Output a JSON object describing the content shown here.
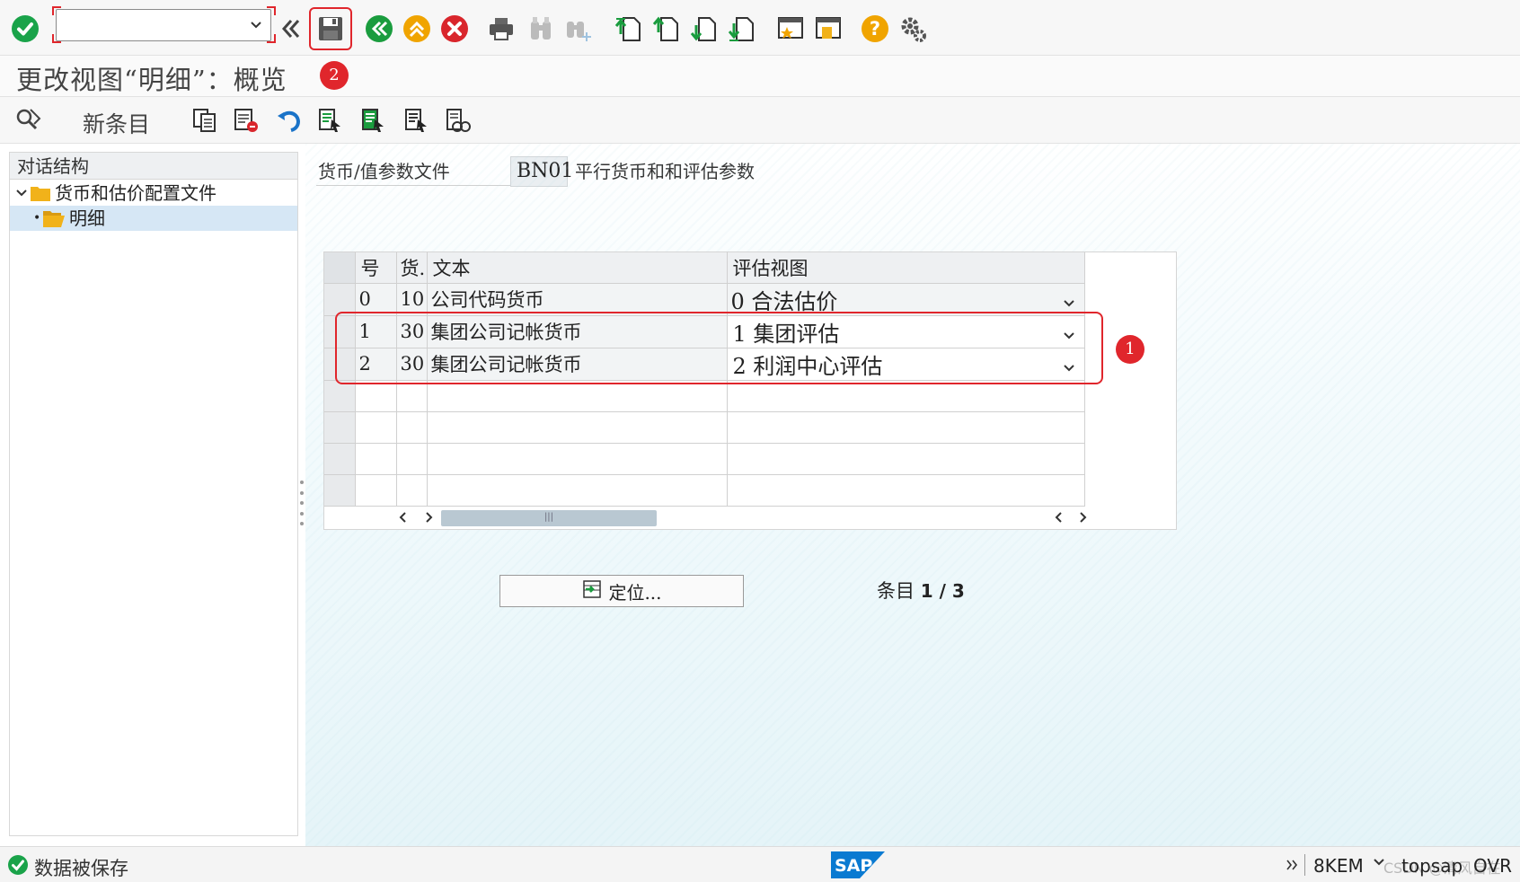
{
  "colors": {
    "check_green": "#1aa34a",
    "nav_green": "#1a9c3e",
    "nav_orange": "#f0a400",
    "cancel_red": "#d9262c",
    "highlight_red": "#e0262c",
    "selection_blue": "#d6e7f5",
    "folder_yellow": "#f1b21a"
  },
  "toolbar": {
    "command_field_value": "",
    "icons": [
      "enter-check-icon",
      "command-field",
      "back-chevron-icon",
      "save-icon",
      "back-icon",
      "exit-icon",
      "cancel-icon",
      "print-icon",
      "find-icon",
      "find-next-icon",
      "first-page-icon",
      "previous-page-icon",
      "next-page-icon",
      "last-page-icon",
      "create-shortcut-icon",
      "new-session-icon",
      "help-icon",
      "customize-layout-icon"
    ]
  },
  "title": "更改视图“明细”：概览",
  "app_toolbar": {
    "new_entries_label": "新条目"
  },
  "tree": {
    "header": "对话结构",
    "nodes": [
      {
        "label": "货币和估价配置文件",
        "level": 0,
        "expanded": true
      },
      {
        "label": "明细",
        "level": 1,
        "selected": true
      }
    ]
  },
  "param": {
    "label": "货币/值参数文件",
    "value": "BN01",
    "description": "平行货币和和评估参数"
  },
  "table": {
    "columns": [
      "号",
      "货.",
      "文本",
      "评估视图"
    ],
    "rows": [
      {
        "no": "0",
        "cur": "10",
        "text": "公司代码货币",
        "view": "0  合法估价"
      },
      {
        "no": "1",
        "cur": "30",
        "text": "集团公司记帐货币",
        "view": "1  集团评估"
      },
      {
        "no": "2",
        "cur": "30",
        "text": "集团公司记帐货币",
        "view": "2  利润中心评估"
      }
    ],
    "empty_rows": 4
  },
  "annotations": {
    "badge_1": "1",
    "badge_2": "2"
  },
  "locate_button": "定位...",
  "entry_label": "条目",
  "entry_count": "1 / 3",
  "status": {
    "message": "数据被保存",
    "system": "8KEM",
    "user": "topsap",
    "mode": "OVR",
    "watermark": "CSDN @清风自在"
  }
}
